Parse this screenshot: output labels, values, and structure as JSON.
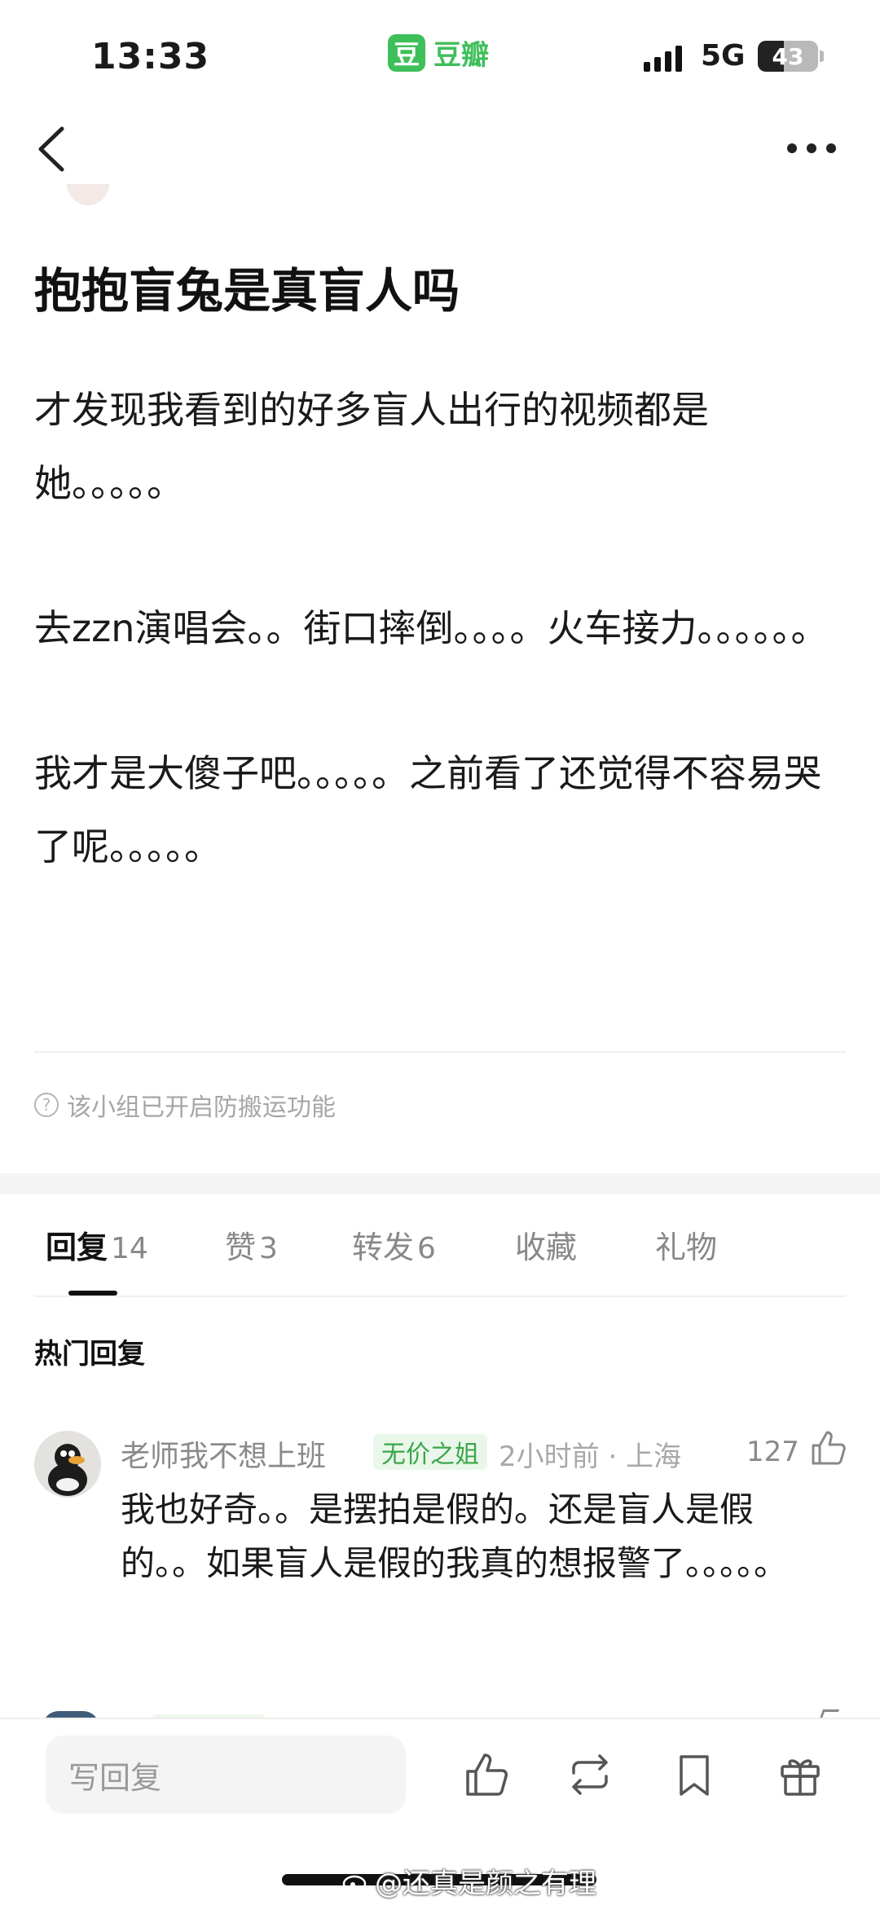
{
  "status_bar": {
    "time": "13:33",
    "app_logo": "豆",
    "app_name": "豆瓣",
    "network": "5G",
    "battery": "43",
    "battery_level": 0.43
  },
  "nav": {
    "back_icon": "chevron-left-icon",
    "more_icon": "more-dots-icon"
  },
  "post": {
    "title": "抱抱盲兔是真盲人吗",
    "paragraphs": [
      "才发现我看到的好多盲人出行的视频都是她。。。。。",
      "去zzn演唱会。。街口摔倒。。。。火车接力。。。。。。",
      "我才是大傻子吧。。。。。之前看了还觉得不容易哭了呢。。。。。"
    ],
    "notice": "该小组已开启防搬运功能",
    "notice_icon": "?"
  },
  "tabs": [
    {
      "label": "回复",
      "count": "14",
      "active": true
    },
    {
      "label": "赞",
      "count": "3",
      "active": false
    },
    {
      "label": "转发",
      "count": "6",
      "active": false
    },
    {
      "label": "收藏",
      "count": "",
      "active": false
    },
    {
      "label": "礼物",
      "count": "",
      "active": false
    }
  ],
  "hot_replies": {
    "title": "热门回复",
    "comments": [
      {
        "author": "老师我不想上班",
        "badge": "无价之姐",
        "meta": "2小时前 · 上海",
        "likes": "127",
        "text": "我也好奇。。是摆拍是假的。还是盲人是假的。。如果盲人是假的我真的想报警了。。。。。"
      }
    ]
  },
  "bottom_bar": {
    "reply_placeholder": "写回复",
    "actions": [
      "thumbs-up-icon",
      "repost-icon",
      "bookmark-icon",
      "gift-icon"
    ]
  },
  "watermark": "@还真是颜之有理",
  "colors": {
    "accent": "#3fbf5a",
    "badge_bg": "#e9f7ea",
    "badge_text": "#3aa64a"
  }
}
